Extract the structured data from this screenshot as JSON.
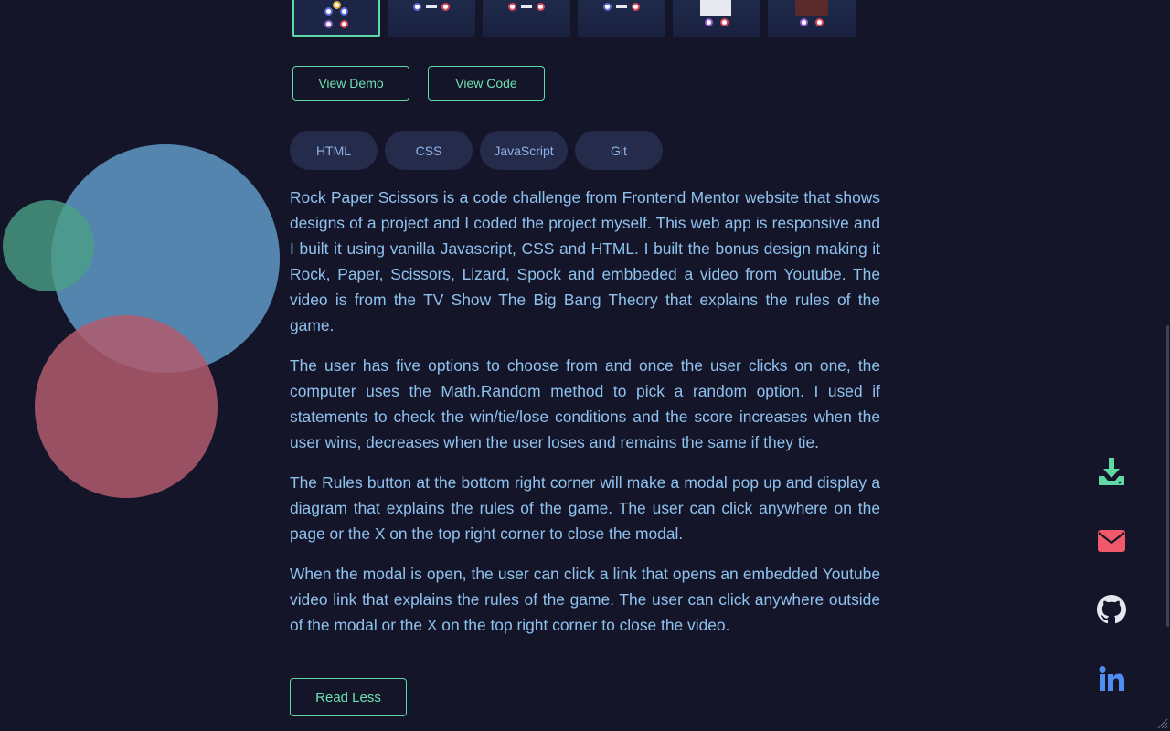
{
  "buttons": {
    "view_demo": "View Demo",
    "view_code": "View Code",
    "read_less": "Read Less"
  },
  "tags": [
    "HTML",
    "CSS",
    "JavaScript",
    "Git"
  ],
  "description": [
    "Rock Paper Scissors is a code challenge from Frontend Mentor website that shows designs of a project and I coded the project myself. This web app is responsive and I built it using vanilla Javascript, CSS and HTML. I built the bonus design making it Rock, Paper, Scissors, Lizard, Spock and embbeded a video from Youtube. The video is from the TV Show The Big Bang Theory that explains the rules of the game.",
    "The user has five options to choose from and once the user clicks on one, the computer uses the Math.Random method to pick a random option. I used if statements to check the win/tie/lose conditions and the score increases when the user wins, decreases when the user loses and remains the same if they tie.",
    "The Rules button at the bottom right corner will make a modal pop up and display a diagram that explains the rules of the game. The user can click anywhere on the page or the X on the top right corner to close the modal.",
    "When the modal is open, the user can click a link that opens an embedded Youtube video link that explains the rules of the game. The user can click anywhere outside of the modal or the X on the top right corner to close the video."
  ],
  "side_icons": [
    "download-icon",
    "mail-icon",
    "github-icon",
    "linkedin-icon"
  ],
  "colors": {
    "background": "#151529",
    "accent": "#5fd8a4",
    "text": "#8ec2ee",
    "tag_bg": "#252b4a",
    "mail": "#f0596a",
    "linkedin": "#4f8ef0"
  }
}
